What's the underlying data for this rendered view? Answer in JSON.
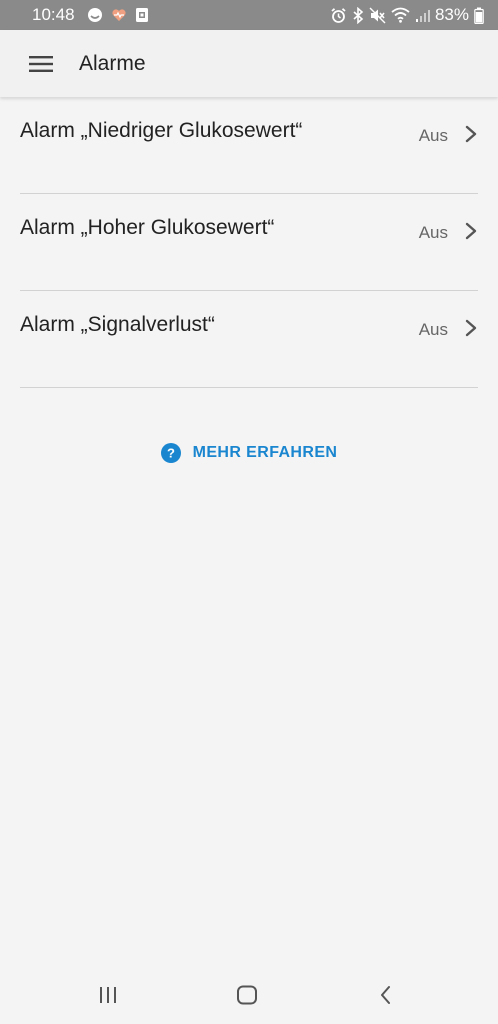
{
  "status_bar": {
    "time": "10:48",
    "battery": "83%",
    "icons": [
      "notification-circle-icon",
      "heart-icon",
      "sim-card-icon",
      "alarm-clock-icon",
      "bluetooth-icon",
      "mute-icon",
      "wifi-icon",
      "signal-icon",
      "battery-icon"
    ]
  },
  "app_bar": {
    "title": "Alarme",
    "menu_icon": "hamburger-menu-icon"
  },
  "alarms": [
    {
      "label": "Alarm „Niedriger Glukosewert“",
      "value": "Aus"
    },
    {
      "label": "Alarm „Hoher Glukosewert“",
      "value": "Aus"
    },
    {
      "label": "Alarm „Signalverlust“",
      "value": "Aus"
    }
  ],
  "learn_more": {
    "label": "MEHR ERFAHREN",
    "icon": "question-circle-icon"
  },
  "nav_bar": {
    "icons": [
      "recent-apps-icon",
      "home-icon",
      "back-icon"
    ]
  },
  "colors": {
    "accent": "#1a86d0",
    "background": "#f4f4f4",
    "status_bar": "#8a8a8a",
    "divider": "#d2d2d2"
  }
}
